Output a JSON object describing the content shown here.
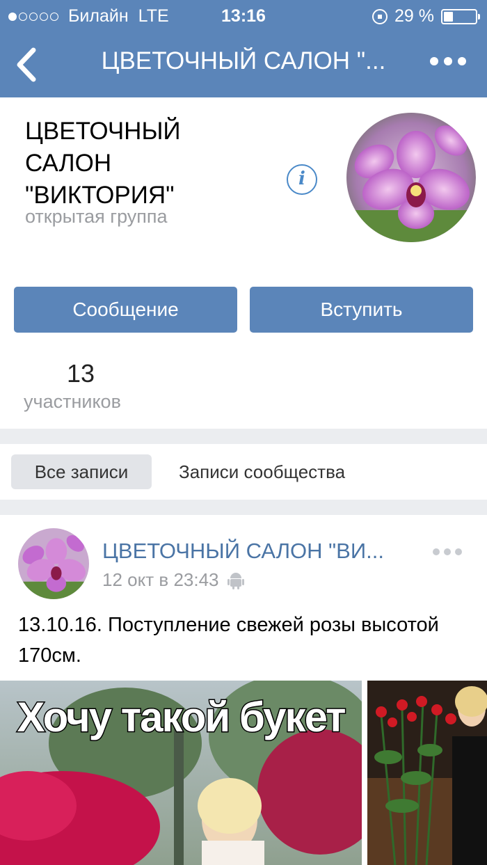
{
  "status_bar": {
    "carrier": "Билайн",
    "network": "LTE",
    "time": "13:16",
    "battery": "29 %",
    "battery_level": 0.29
  },
  "nav": {
    "title": "ЦВЕТОЧНЫЙ САЛОН \"...",
    "back_icon": "chevron-left-icon",
    "more_icon": "more-icon"
  },
  "group": {
    "name": "ЦВЕТОЧНЫЙ САЛОН \"ВИКТОРИЯ\"",
    "type": "открытая группа",
    "info_symbol": "i"
  },
  "actions": {
    "message": "Сообщение",
    "join": "Вступить"
  },
  "stats": {
    "members_count": "13",
    "members_label": "участников"
  },
  "tabs": {
    "all": "Все записи",
    "community": "Записи сообщества"
  },
  "post": {
    "author": "ЦВЕТОЧНЫЙ САЛОН \"ВИ...",
    "time": "12 окт в 23:43",
    "text": "13.10.16. Поступление свежей розы высотой 170см.",
    "photo_caption": "Хочу такой букет"
  },
  "colors": {
    "accent": "#5b85b9",
    "link": "#4a74a5",
    "muted": "#9a9ca0",
    "background": "#ebedf0"
  }
}
